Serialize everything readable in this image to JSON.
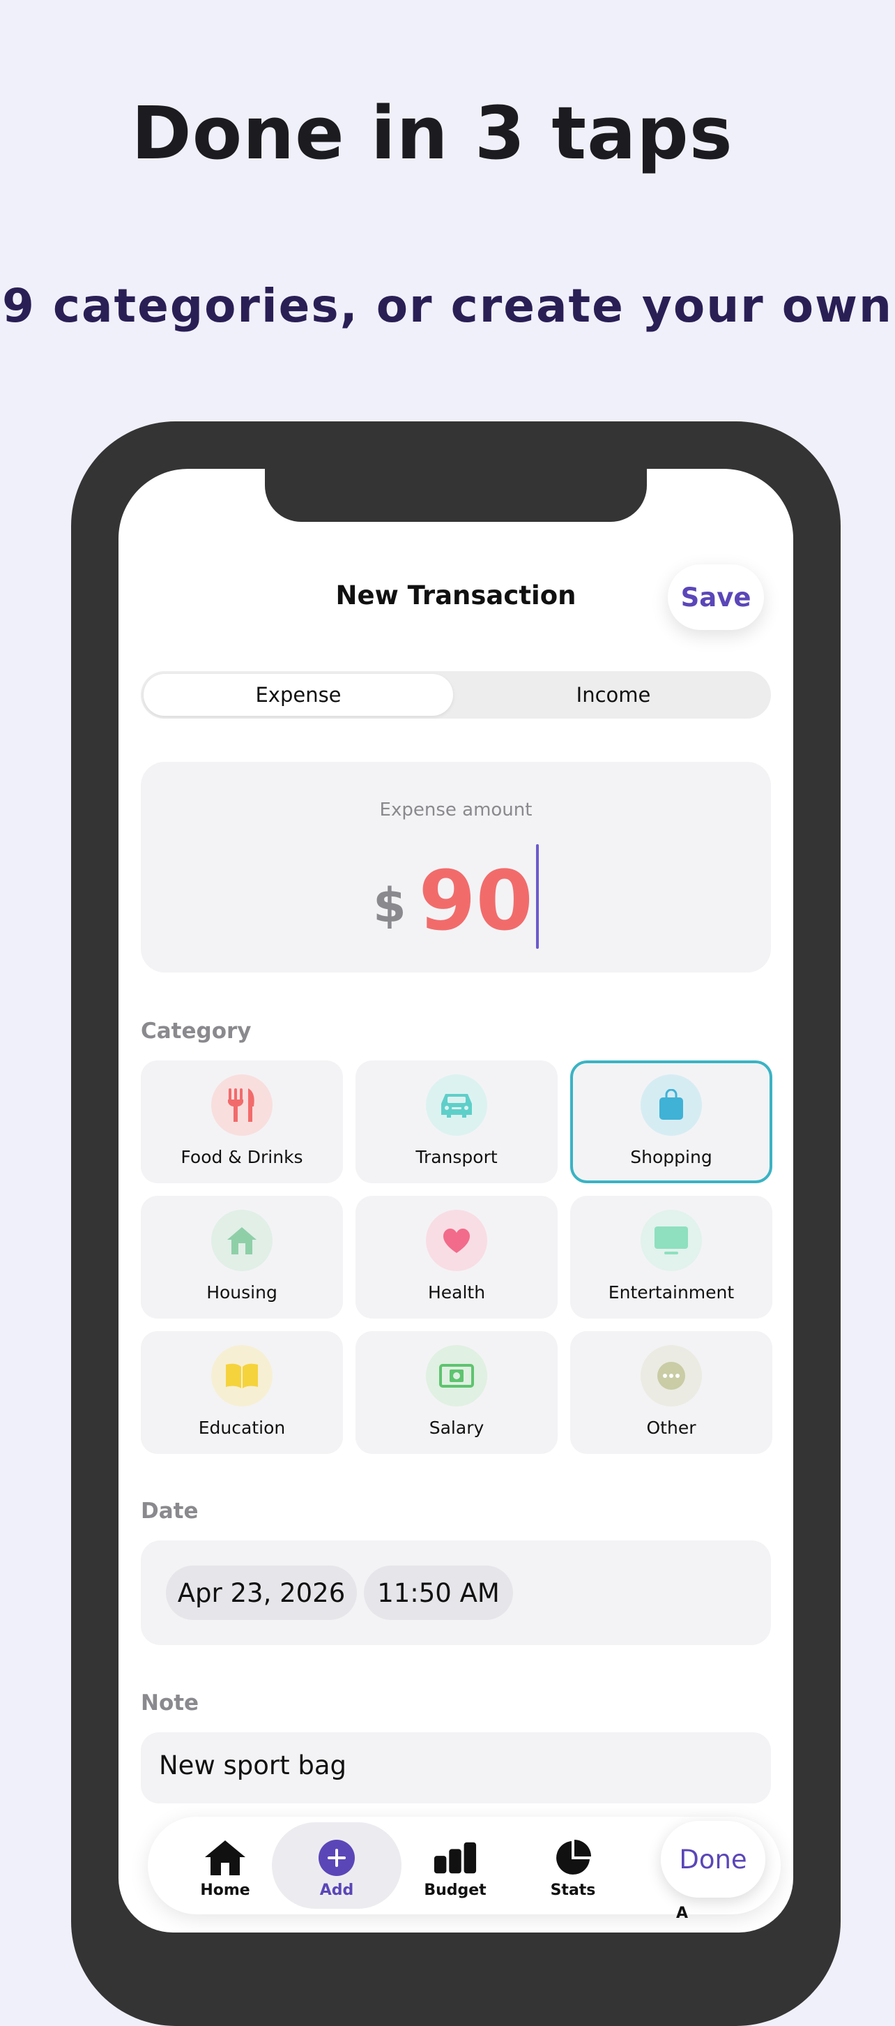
{
  "marketing": {
    "headline": "Done in 3 taps",
    "subheadline": "9 categories, or create your own"
  },
  "header": {
    "title": "New Transaction",
    "save_label": "Save"
  },
  "type_toggle": {
    "options": [
      "Expense",
      "Income"
    ],
    "selected": "Expense"
  },
  "amount": {
    "label": "Expense amount",
    "currency": "$",
    "value": "90"
  },
  "category": {
    "label": "Category",
    "selected": "Shopping",
    "items": [
      {
        "label": "Food & Drinks",
        "icon": "fork-knife-icon",
        "color": "#f26b6b",
        "bg": "#f9dede"
      },
      {
        "label": "Transport",
        "icon": "car-icon",
        "color": "#5fcfc9",
        "bg": "#dcf2f1"
      },
      {
        "label": "Shopping",
        "icon": "shopping-bag-icon",
        "color": "#3fb2d6",
        "bg": "#d6ecf3"
      },
      {
        "label": "Housing",
        "icon": "house-icon",
        "color": "#8fcfa8",
        "bg": "#e1efe7"
      },
      {
        "label": "Health",
        "icon": "heart-icon",
        "color": "#f26b8a",
        "bg": "#f9dde4"
      },
      {
        "label": "Entertainment",
        "icon": "tv-icon",
        "color": "#8ee0bf",
        "bg": "#e2f2ec"
      },
      {
        "label": "Education",
        "icon": "book-icon",
        "color": "#f5d33c",
        "bg": "#f6efd4"
      },
      {
        "label": "Salary",
        "icon": "banknote-icon",
        "color": "#5ec46f",
        "bg": "#e0f0e2"
      },
      {
        "label": "Other",
        "icon": "ellipsis-icon",
        "color": "#c9cca5",
        "bg": "#ebebe3"
      }
    ]
  },
  "date": {
    "label": "Date",
    "date_value": "Apr 23, 2026",
    "time_value": "11:50 AM"
  },
  "note": {
    "label": "Note",
    "value": "New sport bag"
  },
  "tabbar": {
    "items": [
      {
        "label": "Home",
        "icon": "house-icon"
      },
      {
        "label": "Add",
        "icon": "plus-circle-icon"
      },
      {
        "label": "Budget",
        "icon": "bar-chart-icon"
      },
      {
        "label": "Stats",
        "icon": "pie-chart-icon"
      }
    ],
    "active": "Add",
    "partial_label": "A"
  },
  "keyboard_toolbar": {
    "done_label": "Done"
  },
  "colors": {
    "accent": "#5b46b8",
    "amount": "#f26b6b",
    "selected_border": "#3ab3c4",
    "background": "#f0f0fa"
  }
}
